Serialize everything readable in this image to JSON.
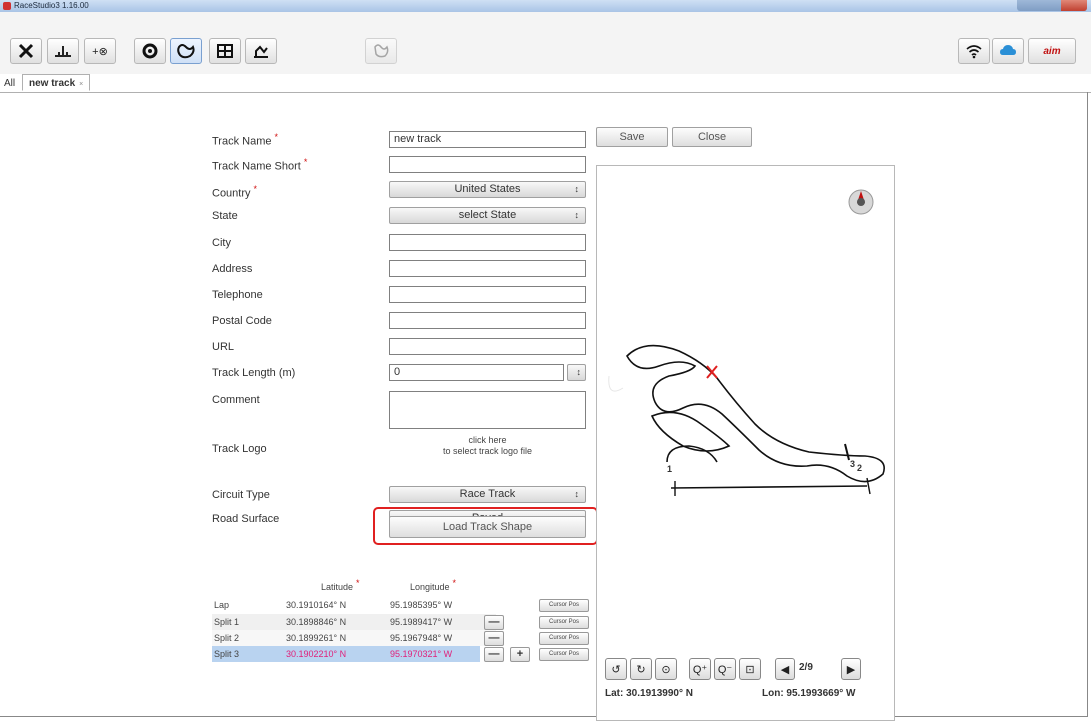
{
  "window": {
    "title": "RaceStudio3 1.16.00"
  },
  "tabs": {
    "all_label": "All",
    "active_label": "new track",
    "close_glyph": "×"
  },
  "actions": {
    "save_label": "Save",
    "close_label": "Close"
  },
  "form": {
    "track_name": {
      "label": "Track Name",
      "value": "new track",
      "required_mark": "*"
    },
    "track_name_short": {
      "label": "Track Name Short",
      "value": "",
      "required_mark": "*"
    },
    "country": {
      "label": "Country",
      "value": "United States",
      "required_mark": "*"
    },
    "state": {
      "label": "State",
      "value": "select State"
    },
    "city": {
      "label": "City",
      "value": ""
    },
    "address": {
      "label": "Address",
      "value": ""
    },
    "telephone": {
      "label": "Telephone",
      "value": ""
    },
    "postal_code": {
      "label": "Postal Code",
      "value": ""
    },
    "url": {
      "label": "URL",
      "value": ""
    },
    "track_length": {
      "label": "Track Length (m)",
      "value": "0"
    },
    "comment": {
      "label": "Comment",
      "value": ""
    },
    "track_logo": {
      "label": "Track Logo",
      "hint_line1": "click here",
      "hint_line2": "to select track logo file"
    },
    "circuit_type": {
      "label": "Circuit Type",
      "value": "Race Track"
    },
    "road_surface": {
      "label": "Road Surface",
      "value": "Paved"
    },
    "load_shape_label": "Load Track Shape",
    "select_arrow": "↕"
  },
  "coords": {
    "lat_header": "Latitude",
    "lon_header": "Longitude",
    "required_mark": "*",
    "cursor_pos_label": "Cursor Pos",
    "minus_label": "—",
    "plus_label": "+",
    "rows": [
      {
        "name": "Lap",
        "lat": "30.1910164° N",
        "lon": "95.1985395° W"
      },
      {
        "name": "Split 1",
        "lat": "30.1898846° N",
        "lon": "95.1989417° W"
      },
      {
        "name": "Split 2",
        "lat": "30.1899261° N",
        "lon": "95.1967948° W"
      },
      {
        "name": "Split 3",
        "lat": "30.1902210° N",
        "lon": "95.1970321° W"
      }
    ]
  },
  "map": {
    "marker_labels": [
      "1",
      "3",
      "2"
    ],
    "page_indicator": "2/9",
    "lat_readout": "Lat: 30.1913990° N",
    "lon_readout": "Lon: 95.1993669° W"
  },
  "colors": {
    "required": "#d01010",
    "selected_row": "#b9d3f0",
    "selected_text": "#e0207a",
    "highlight": "#e02020"
  }
}
